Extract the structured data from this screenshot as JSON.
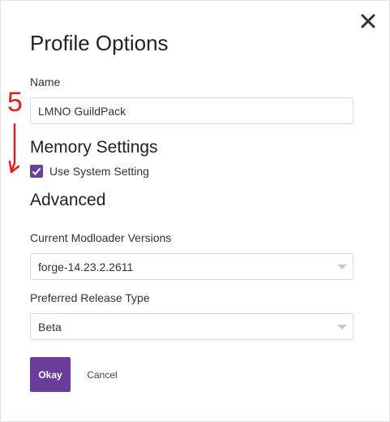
{
  "dialog": {
    "title": "Profile Options",
    "close_icon": "close-icon"
  },
  "name_field": {
    "label": "Name",
    "value": "LMNO GuildPack"
  },
  "memory": {
    "heading": "Memory Settings",
    "checkbox_label": "Use System Setting",
    "checked": true
  },
  "advanced": {
    "heading": "Advanced",
    "modloader_label": "Current Modloader Versions",
    "modloader_value": "forge-14.23.2.2611",
    "release_label": "Preferred Release Type",
    "release_value": "Beta"
  },
  "actions": {
    "okay_label": "Okay",
    "cancel_label": "Cancel"
  },
  "annotation": {
    "number": "5"
  },
  "colors": {
    "accent": "#6a3d9a",
    "annotation": "#e02020"
  }
}
